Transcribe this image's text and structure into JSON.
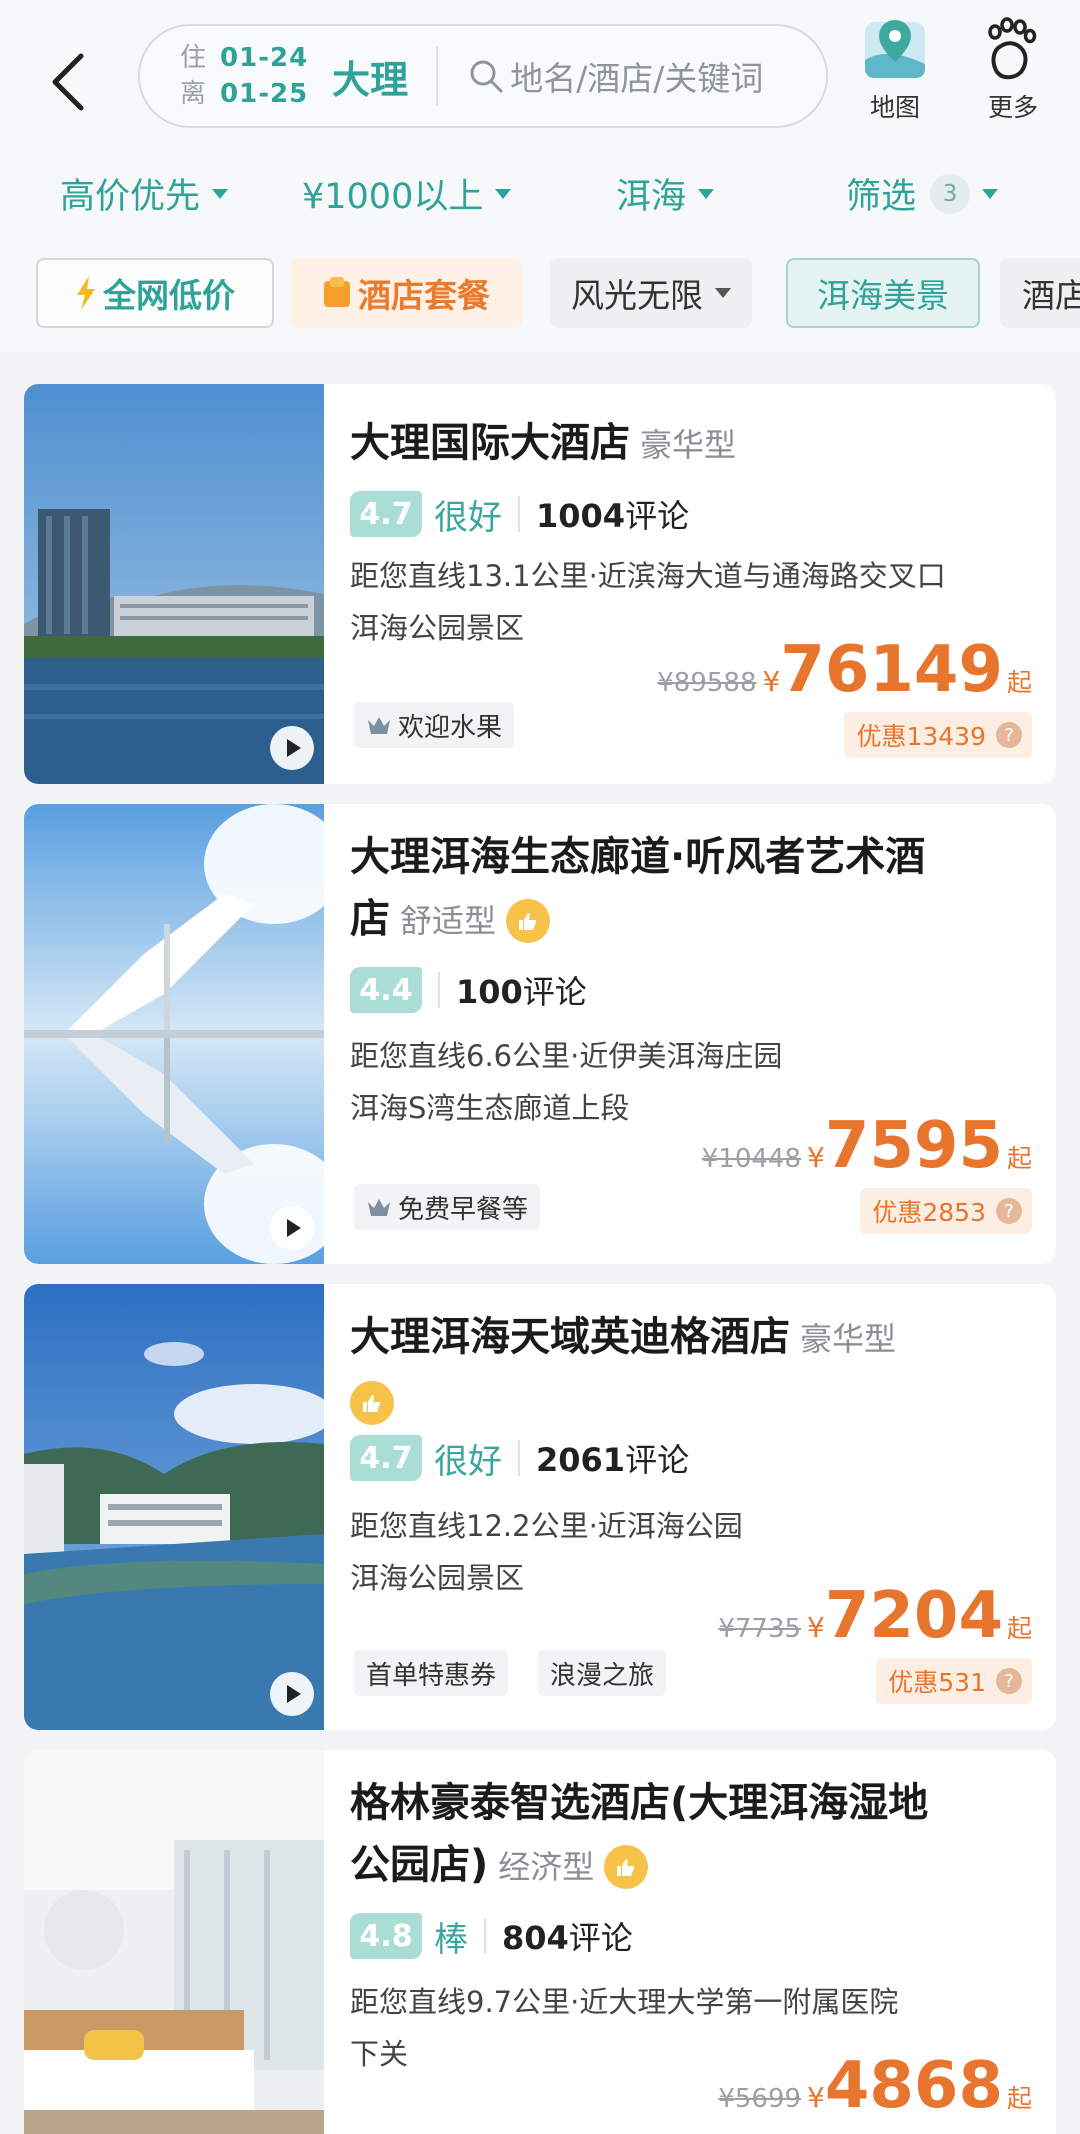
{
  "header": {
    "checkin_label": "住",
    "checkin_date": "01-24",
    "checkout_label": "离",
    "checkout_date": "01-25",
    "city": "大理",
    "search_placeholder": "地名/酒店/关键词",
    "map_label": "地图",
    "more_label": "更多"
  },
  "filters": {
    "sort": "高价优先",
    "price": "¥1000以上",
    "location": "洱海",
    "filter": "筛选",
    "filter_count": "3"
  },
  "tags": {
    "lowprice": "全网低价",
    "package": "酒店套餐",
    "scenery": "风光无限",
    "lakeview": "洱海美景",
    "hotel": "酒店"
  },
  "hotels": [
    {
      "name": "大理国际大酒店",
      "type": "豪华型",
      "score": "4.7",
      "score_label": "很好",
      "reviews": "1004",
      "reviews_suffix": "评论",
      "distance": "距您直线13.1公里·近滨海大道与通海路交叉口",
      "area": "洱海公园景区",
      "old_price": "¥89588",
      "currency": "¥",
      "price": "76149",
      "price_suffix": "起",
      "discount": "优惠13439",
      "perks": [
        "欢迎水果"
      ]
    },
    {
      "name": "大理洱海生态廊道·听风者艺术酒店",
      "name_line1": "大理洱海生态廊道·听风者艺术酒",
      "name_line2": "店",
      "type": "舒适型",
      "score": "4.4",
      "score_label": "",
      "reviews": "100",
      "reviews_suffix": "评论",
      "distance": "距您直线6.6公里·近伊美洱海庄园",
      "area": "洱海S湾生态廊道上段",
      "old_price": "¥10448",
      "currency": "¥",
      "price": "7595",
      "price_suffix": "起",
      "discount": "优惠2853",
      "perks": [
        "免费早餐等"
      ]
    },
    {
      "name": "大理洱海天域英迪格酒店",
      "type": "豪华型",
      "score": "4.7",
      "score_label": "很好",
      "reviews": "2061",
      "reviews_suffix": "评论",
      "distance": "距您直线12.2公里·近洱海公园",
      "area": "洱海公园景区",
      "old_price": "¥7735",
      "currency": "¥",
      "price": "7204",
      "price_suffix": "起",
      "discount": "优惠531",
      "perks": [
        "首单特惠券",
        "浪漫之旅"
      ]
    },
    {
      "name": "格林豪泰智选酒店(大理洱海湿地公园店)",
      "name_line1": "格林豪泰智选酒店(大理洱海湿地",
      "name_line2": "公园店)",
      "type": "经济型",
      "score": "4.8",
      "score_label": "棒",
      "reviews": "804",
      "reviews_suffix": "评论",
      "distance": "距您直线9.7公里·近大理大学第一附属医院",
      "area": "下关",
      "old_price": "¥5699",
      "currency": "¥",
      "price": "4868",
      "price_suffix": "起"
    }
  ],
  "colors": {
    "accent": "#2fa39a",
    "price": "#e8752d",
    "score_bg": "#a9ddd6"
  }
}
